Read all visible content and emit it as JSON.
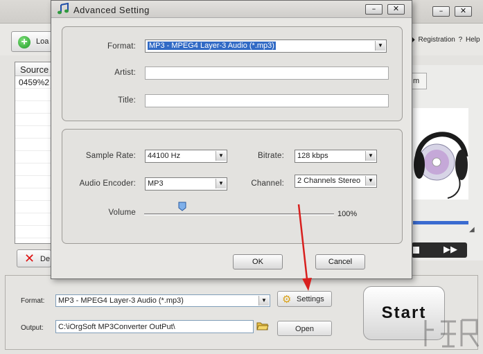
{
  "main": {
    "load_label": "Loa",
    "registration_label": "Registration",
    "help_label": "Help",
    "help_icon": "?",
    "file_list": {
      "header": "Source",
      "rows": [
        "0459%2"
      ]
    },
    "delete_label": "De",
    "preview_tab_label": "m",
    "window_buttons": [
      "–",
      "✕"
    ]
  },
  "bottom": {
    "format_label": "Format:",
    "format_value": "MP3 - MPEG4 Layer-3 Audio (*.mp3)",
    "settings_label": "Settings",
    "output_label": "Output:",
    "output_value": "C:\\iOrgSoft MP3Converter OutPut\\",
    "open_label": "Open",
    "start_label": "Start"
  },
  "dialog": {
    "title": "Advanced  Setting",
    "window_buttons": [
      "–",
      "✕"
    ],
    "format": {
      "label": "Format:",
      "value": "MP3 - MPEG4 Layer-3 Audio (*.mp3)"
    },
    "artist": {
      "label": "Artist:",
      "value": ""
    },
    "title_field": {
      "label": "Title:",
      "value": ""
    },
    "sample_rate": {
      "label": "Sample Rate:",
      "value": "44100 Hz"
    },
    "bitrate": {
      "label": "Bitrate:",
      "value": "128 kbps"
    },
    "audio_encoder": {
      "label": "Audio Encoder:",
      "value": "MP3"
    },
    "channel": {
      "label": "Channel:",
      "value": "2 Channels Stereo"
    },
    "volume": {
      "label": "Volume",
      "value_text": "100%",
      "level": 0.2
    },
    "ok_label": "OK",
    "cancel_label": "Cancel"
  },
  "colors": {
    "selection": "#316ac5",
    "arrow": "#d8201e",
    "progress": "#3a6bd0"
  }
}
